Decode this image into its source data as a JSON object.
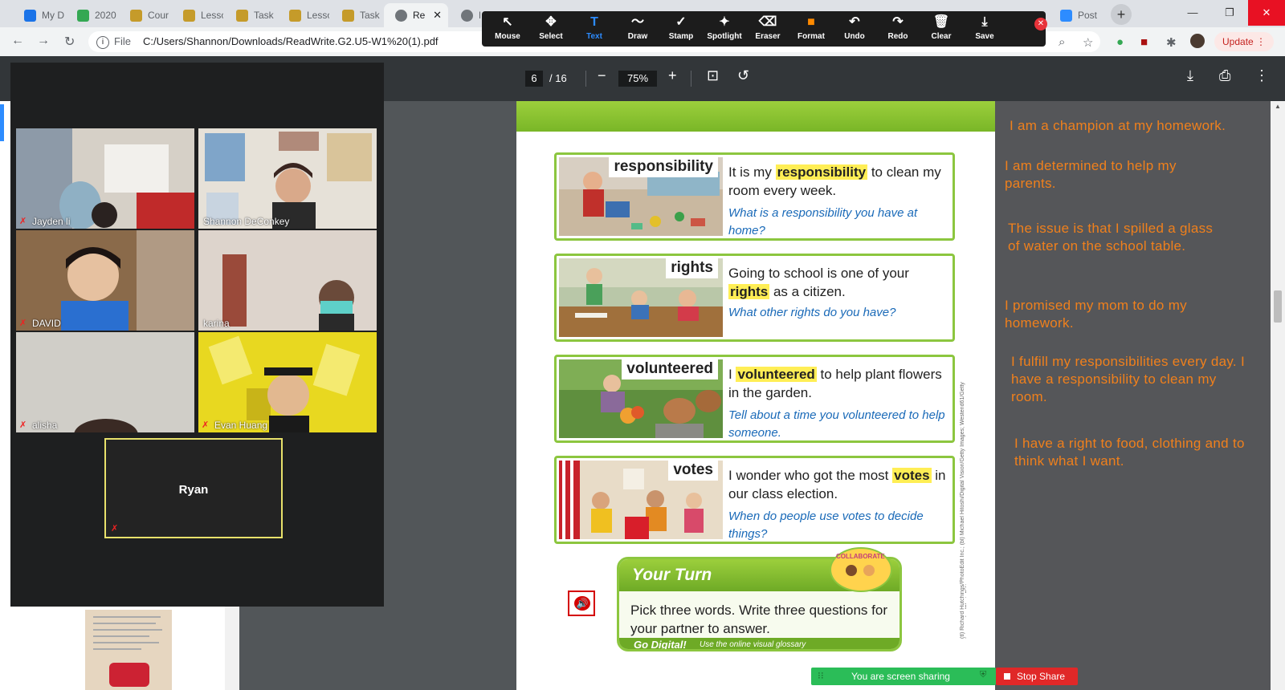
{
  "browser": {
    "tabs": [
      {
        "label": "My D",
        "fav": "#1a73e8"
      },
      {
        "label": "2020",
        "fav": "#34a853"
      },
      {
        "label": "Cour",
        "fav": "#c59b2a"
      },
      {
        "label": "Lesso",
        "fav": "#c59b2a"
      },
      {
        "label": "Task",
        "fav": "#c59b2a"
      },
      {
        "label": "Lesso",
        "fav": "#c59b2a"
      },
      {
        "label": "Task",
        "fav": "#c59b2a"
      },
      {
        "label": "Re",
        "fav": "#70757a"
      },
      {
        "label": "Pr",
        "fav": "#70757a"
      },
      {
        "label": "Post",
        "fav": "#2d8cff"
      }
    ],
    "active_tab_close": "✕",
    "new_tab": "+",
    "scheme": "File",
    "url": "C:/Users/Shannon/Downloads/ReadWrite.G2.U5-W1%20(1).pdf",
    "update_label": "Update"
  },
  "annotate_toolbar": {
    "tools": [
      {
        "label": "Mouse",
        "icon": "↖",
        "icon_name": "cursor-icon"
      },
      {
        "label": "Select",
        "icon": "✥",
        "icon_name": "move-icon"
      },
      {
        "label": "Text",
        "icon": "T",
        "icon_name": "text-icon"
      },
      {
        "label": "Draw",
        "icon": "〜",
        "icon_name": "draw-icon"
      },
      {
        "label": "Stamp",
        "icon": "✓",
        "icon_name": "check-icon"
      },
      {
        "label": "Spotlight",
        "icon": "✦",
        "icon_name": "spotlight-icon"
      },
      {
        "label": "Eraser",
        "icon": "⌫",
        "icon_name": "eraser-icon"
      },
      {
        "label": "Format",
        "icon": "■",
        "icon_name": "format-icon"
      },
      {
        "label": "Undo",
        "icon": "↶",
        "icon_name": "undo-icon"
      },
      {
        "label": "Redo",
        "icon": "↷",
        "icon_name": "redo-icon"
      },
      {
        "label": "Clear",
        "icon": "🗑",
        "icon_name": "trash-icon"
      },
      {
        "label": "Save",
        "icon": "⤓",
        "icon_name": "save-icon"
      }
    ],
    "selected": "Text"
  },
  "pdf_toolbar": {
    "page": "6",
    "of_pages": "/ 16",
    "zoom": "75%"
  },
  "vocab": [
    {
      "word": "responsibility",
      "pre": "It is my ",
      "hl": "responsibility",
      "post": " to clean my room every week.",
      "question": "What is a responsibility you have at home?"
    },
    {
      "word": "rights",
      "pre": "Going to school is one of your ",
      "hl": "rights",
      "post": " as a citizen.",
      "question": "What other rights do you have?"
    },
    {
      "word": "volunteered",
      "pre": "I ",
      "hl": "volunteered",
      "post": " to help plant flowers in the garden.",
      "question": "Tell about a time you volunteered to help someone."
    },
    {
      "word": "votes",
      "pre": "I wonder who got the most ",
      "hl": "votes",
      "post": " in our class election.",
      "question": "When do people use votes to decide things?"
    }
  ],
  "your_turn": {
    "title": "Your Turn",
    "body": "Pick three words. Write three questions for your partner to answer.",
    "go_digital": "Go Digital!",
    "go_digital_sub": "Use the online visual glossary",
    "collaborate": "COLLABORATE"
  },
  "credit_text": "(tl) Richard Hutchings/PhotoEdit Inc.; (bl) Michael Hitoshi/Digital Vision/Getty Images; Westend61/Getty Images; Inc/PhotoEdit",
  "notes": [
    "I am a champion at my homework.",
    "I am determined to help my parents.",
    "The issue is that I spilled a glass of water on the school table.",
    "I promised my mom to do my homework.",
    "I fulfill my responsibilities every day. I have a responsibility to clean my room.",
    "I have a right to food, clothing and to think what I want."
  ],
  "participants": [
    {
      "name": "Jayden li",
      "muted": true
    },
    {
      "name": "Shannon DeConkey",
      "muted": false
    },
    {
      "name": "DAVID",
      "muted": true
    },
    {
      "name": "karina",
      "muted": false
    },
    {
      "name": "alisha",
      "muted": true
    },
    {
      "name": "Evan Huang",
      "muted": true
    }
  ],
  "active_speaker": {
    "name": "Ryan"
  },
  "screen_share": {
    "status": "You are screen sharing",
    "stop": "Stop Share"
  },
  "colors": {
    "note_text": "#f0801c",
    "vocab_border": "#8cc63f",
    "highlight": "#ffee55",
    "zoom_blue": "#2d8cff",
    "stop_red": "#e02828",
    "share_green": "#2bbd58"
  }
}
